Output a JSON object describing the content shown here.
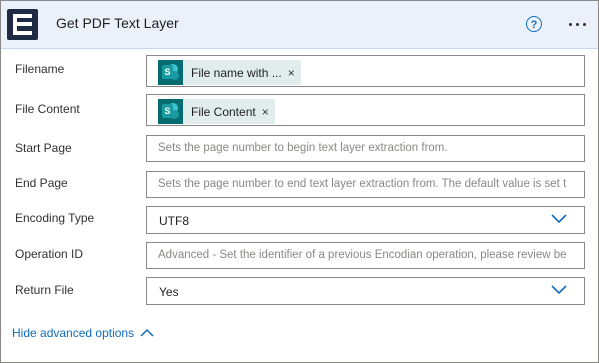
{
  "header": {
    "title": "Get PDF Text Layer",
    "help_symbol": "?",
    "icon": "encodian-logo-icon",
    "menu_icon": "more-options-icon"
  },
  "fields": {
    "filename": {
      "label": "Filename",
      "token_label": "File name with ...",
      "token_icon": "sharepoint-icon",
      "token_remove": "×"
    },
    "file_content": {
      "label": "File Content",
      "token_label": "File Content",
      "token_icon": "sharepoint-icon",
      "token_remove": "×"
    },
    "start_page": {
      "label": "Start Page",
      "placeholder": "Sets the page number to begin text layer extraction from."
    },
    "end_page": {
      "label": "End Page",
      "placeholder": "Sets the page number to end text layer extraction from. The default value is set t"
    },
    "encoding_type": {
      "label": "Encoding Type",
      "value": "UTF8"
    },
    "operation_id": {
      "label": "Operation ID",
      "placeholder": "Advanced - Set the identifier of a previous Encodian operation, please review be"
    },
    "return_file": {
      "label": "Return File",
      "value": "Yes"
    }
  },
  "footer": {
    "advanced_toggle": "Hide advanced options"
  },
  "colors": {
    "accent": "#0f6cbd",
    "header_bg": "#eaf1fb",
    "sharepoint_teal": "#036c70",
    "token_bg": "#e1ecec"
  }
}
